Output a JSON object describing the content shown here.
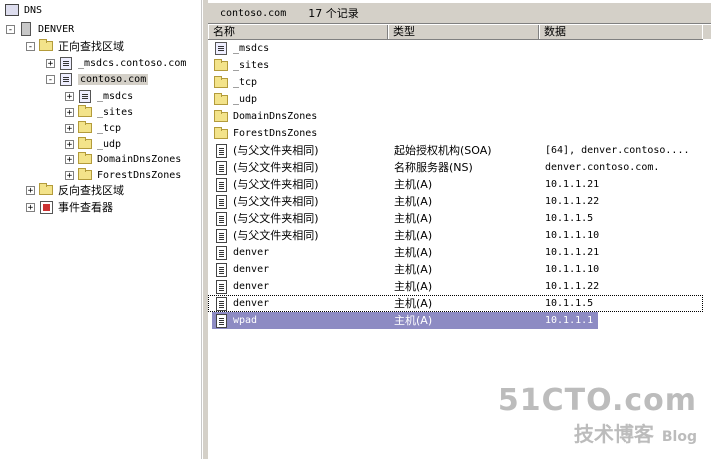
{
  "tree": {
    "root": "DNS",
    "server": "DENVER",
    "forward_zones": "正向查找区域",
    "msdcs_zone": "_msdcs.contoso.com",
    "contoso_zone": "contoso.com",
    "children": [
      "_msdcs",
      "_sites",
      "_tcp",
      "_udp",
      "DomainDnsZones",
      "ForestDnsZones"
    ],
    "reverse_zones": "反向查找区域",
    "event_viewer": "事件查看器"
  },
  "status": {
    "zone": "contoso.com",
    "count": "17 个记录"
  },
  "columns": {
    "name": "名称",
    "type": "类型",
    "data": "数据"
  },
  "folders": [
    "_msdcs",
    "_sites",
    "_tcp",
    "_udp",
    "DomainDnsZones",
    "ForestDnsZones"
  ],
  "records": [
    {
      "name": "(与父文件夹相同)",
      "type": "起始授权机构(SOA)",
      "data": "[64], denver.contoso...."
    },
    {
      "name": "(与父文件夹相同)",
      "type": "名称服务器(NS)",
      "data": "denver.contoso.com."
    },
    {
      "name": "(与父文件夹相同)",
      "type": "主机(A)",
      "data": "10.1.1.21"
    },
    {
      "name": "(与父文件夹相同)",
      "type": "主机(A)",
      "data": "10.1.1.22"
    },
    {
      "name": "(与父文件夹相同)",
      "type": "主机(A)",
      "data": "10.1.1.5"
    },
    {
      "name": "(与父文件夹相同)",
      "type": "主机(A)",
      "data": "10.1.1.10"
    },
    {
      "name": "denver",
      "type": "主机(A)",
      "data": "10.1.1.21"
    },
    {
      "name": "denver",
      "type": "主机(A)",
      "data": "10.1.1.10"
    },
    {
      "name": "denver",
      "type": "主机(A)",
      "data": "10.1.1.22"
    },
    {
      "name": "denver",
      "type": "主机(A)",
      "data": "10.1.1.5"
    },
    {
      "name": "wpad",
      "type": "主机(A)",
      "data": "10.1.1.1"
    }
  ],
  "watermark": {
    "line1": "51CTO.com",
    "line2": "技术博客",
    "line3": "Blog"
  },
  "colors": {
    "selection": "#8d8bc3",
    "chrome": "#d4d0c8",
    "folder": "#f3e38a"
  }
}
